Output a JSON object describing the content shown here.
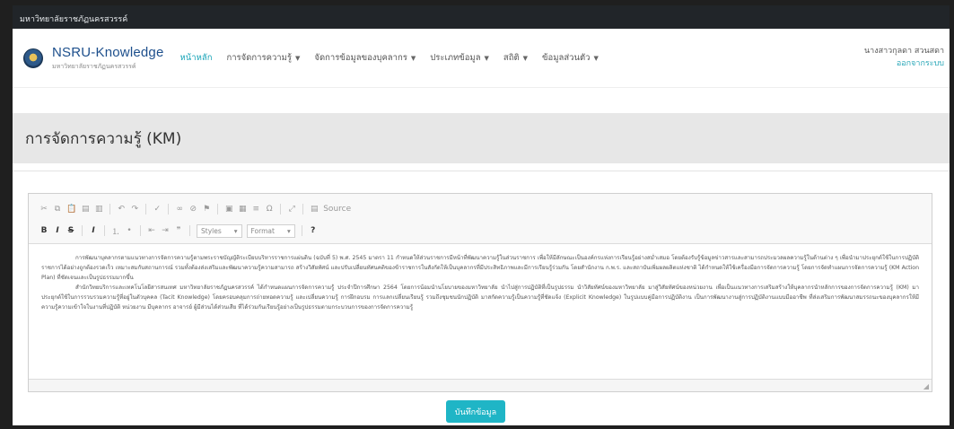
{
  "topbar": {
    "text": "มหาวิทยาลัยราชภัฏนครสวรรค์"
  },
  "brand": {
    "title": "NSRU-Knowledge",
    "subtitle": "มหาวิทยาลัยราชภัฏนครสวรรค์"
  },
  "nav": {
    "items": [
      {
        "label": "หน้าหลัก",
        "dropdown": false,
        "active": true
      },
      {
        "label": "การจัดการความรู้",
        "dropdown": true,
        "active": false
      },
      {
        "label": "จัดการข้อมูลของบุคลากร",
        "dropdown": true,
        "active": false
      },
      {
        "label": "ประเภทข้อมูล",
        "dropdown": true,
        "active": false
      },
      {
        "label": "สถิติ",
        "dropdown": true,
        "active": false
      },
      {
        "label": "ข้อมูลส่วนตัว",
        "dropdown": true,
        "active": false
      }
    ]
  },
  "user": {
    "name": "นางสาวกุลดา สวนสดา",
    "logout": "ออกจากระบบ"
  },
  "page": {
    "title": "การจัดการความรู้ (KM)"
  },
  "editor": {
    "source_label": "Source",
    "styles_label": "Styles",
    "format_label": "Format",
    "paragraphs": [
      "การพัฒนาบุคลากรตามแนวทางการจัดการความรู้ตามพระราชบัญญัติระเบียบบริหารราชการแผ่นดิน (ฉบับที่ 5) พ.ศ. 2545 มาตรา 11 กำหนดให้ส่วนราชการมีหน้าที่พัฒนาความรู้ในส่วนราชการ เพื่อให้มีลักษณะเป็นองค์กรแห่งการเรียนรู้อย่างสม่ำเสมอ โดยต้องรับรู้ข้อมูลข่าวสารและสามารถประมวลผลความรู้ในด้านต่าง ๆ เพื่อนำมาประยุกต์ใช้ในการปฏิบัติราชการได้อย่างถูกต้องรวดเร็ว เหมาะสมกับสถานการณ์ รวมทั้งต้องส่งเสริมและพัฒนาความรู้ความสามารถ สร้างวิสัยทัศน์ และปรับเปลี่ยนทัศนคติของข้าราชการในสังกัดให้เป็นบุคลากรที่มีประสิทธิภาพและมีการเรียนรู้ร่วมกัน โดยสำนักงาน ก.พ.ร. และสถาบันเพิ่มผลผลิตแห่งชาติ ได้กำหนดให้ใช้เครื่องมือการจัดการความรู้ โดยการจัดทำแผนการจัดการความรู้ (KM Action Plan) ที่ชัดเจนและเป็นรูปธรรมมากขึ้น",
      "สำนักวิทยบริการและเทคโนโลยีสารสนเทศ มหาวิทยาลัยราชภัฏนครสวรรค์ ได้กำหนดแผนการจัดการความรู้ ประจำปีการศึกษา 2564 โดยการน้อมนำนโยบายของมหาวิทยาลัย นำไปสู่การปฏิบัติที่เป็นรูปธรรม นำวิสัยทัศน์ของมหาวิทยาลัย มาสู่วิสัยทัศน์ของหน่วยงาน เพื่อเป็นแนวทางการเสริมสร้างให้บุคลากรนำหลักการของการจัดการความรู้ (KM) มาประยุกต์ใช้ในการรวบรวมความรู้ที่อยู่ในตัวบุคคล (Tacit Knowledge) โดยครอบคลุมการถ่ายทอดความรู้ และเปลี่ยนความรู้ การฝึกอบรม การแลกเปลี่ยนเรียนรู้ รวมถึงชุมชนนักปฏิบัติ มาสกัดความรู้เป็นความรู้ที่ชัดแจ้ง (Explicit Knowledge) ในรูปแบบคู่มือการปฏิบัติงาน เป็นการพัฒนางานสู่การปฏิบัติงานแบบมืออาชีพ ที่ส่งเสริมการพัฒนาสมรรถนะของบุคลากรให้มีความรู้ความเข้าใจในงานที่ปฏิบัติ หน่วยงาน มีบุคลากร อาจารย์ ผู้มีส่วนได้ส่วนเสีย ที่ได้ร่วมกันเรียนรู้อย่างเป็นรูปธรรมตามกระบวนการของการจัดการความรู้"
    ]
  },
  "actions": {
    "save_label": "บันทึกข้อมูล"
  },
  "colors": {
    "accent": "#1fb5c6",
    "brand": "#1d4f8c",
    "topbar": "#212529",
    "title_band": "#e7e7e7"
  }
}
